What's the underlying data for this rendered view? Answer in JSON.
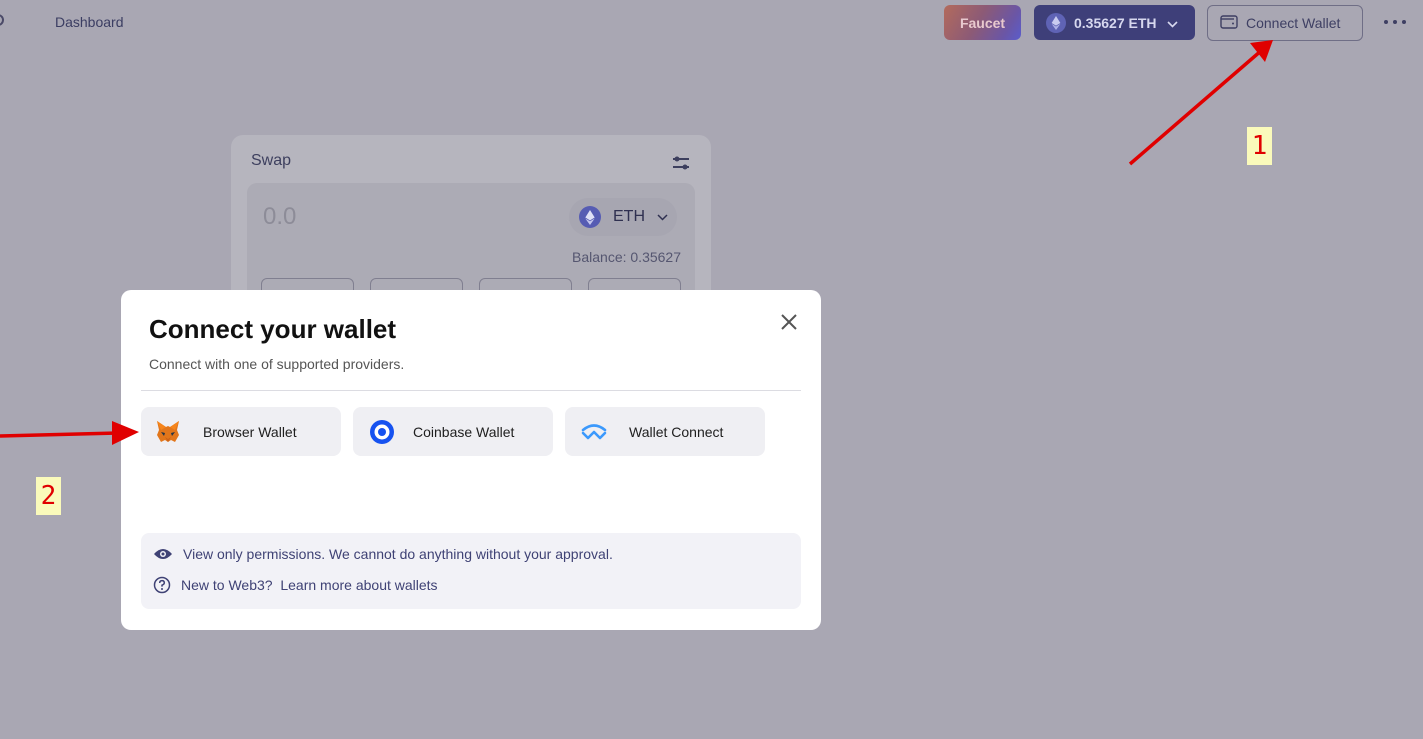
{
  "topbar": {
    "nav_dashboard": "Dashboard",
    "faucet_label": "Faucet",
    "balance_amount": "0.35627",
    "balance_unit": "ETH",
    "connect_label": "Connect Wallet"
  },
  "swap": {
    "title": "Swap",
    "amount": "0.0",
    "token": "ETH",
    "balance": "Balance: 0.35627"
  },
  "modal": {
    "title": "Connect your wallet",
    "subtitle": "Connect with one of supported providers.",
    "options": [
      {
        "label": "Browser Wallet",
        "icon": "metamask-fox-icon"
      },
      {
        "label": "Coinbase Wallet",
        "icon": "coinbase-icon"
      },
      {
        "label": "Wallet Connect",
        "icon": "walletconnect-icon"
      }
    ],
    "info": {
      "permissions": "View only permissions. We cannot do anything without your approval.",
      "new_prefix": "New to Web3?",
      "learn_link": "Learn more about wallets"
    }
  },
  "annotations": {
    "marker_1": "1",
    "marker_2": "2"
  },
  "colors": {
    "overlay_bg": "#a9a7b3",
    "balance_btn": "#3e3f79",
    "annotation_red": "#e00000",
    "marker_bg": "#fafabb",
    "coinbase_blue": "#1652f0",
    "walletconnect_blue": "#3b99fc"
  }
}
